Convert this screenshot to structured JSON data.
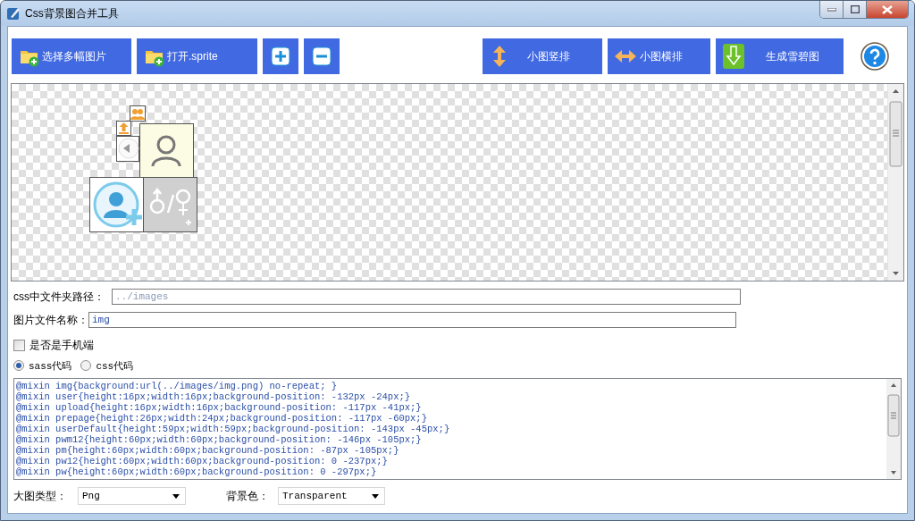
{
  "window": {
    "title": "Css背景图合并工具"
  },
  "toolbar": [
    {
      "kind": "folder",
      "label": "选择多幅图片"
    },
    {
      "kind": "folder",
      "label": "打开.sprite"
    },
    {
      "kind": "plus"
    },
    {
      "kind": "minus"
    },
    {
      "kind": "vertical",
      "label": "小图竖排"
    },
    {
      "kind": "horizontal",
      "label": "小图横排"
    },
    {
      "kind": "generate",
      "label": "生成雪碧图"
    },
    {
      "kind": "help"
    }
  ],
  "css_folder_path": {
    "label": "css中文件夹路径：",
    "value": "../images"
  },
  "image_file_name": {
    "label": "图片文件名称：",
    "value": "img"
  },
  "mobile_checkbox": {
    "label": "是否是手机端",
    "checked": false
  },
  "code_format": [
    {
      "label": "sass代码",
      "selected": true
    },
    {
      "label": "css代码",
      "selected": false
    }
  ],
  "code_output": [
    "@mixin img{background:url(../images/img.png) no-repeat; }",
    "@mixin user{height:16px;width:16px;background-position: -132px -24px;}",
    "@mixin upload{height:16px;width:16px;background-position: -117px -41px;}",
    "@mixin prepage{height:26px;width:24px;background-position: -117px -60px;}",
    "@mixin userDefault{height:59px;width:59px;background-position: -143px -45px;}",
    "@mixin pwm12{height:60px;width:60px;background-position: -146px -105px;}",
    "@mixin pm{height:60px;width:60px;background-position: -87px -105px;}",
    "@mixin pw12{height:60px;width:60px;background-position: 0 -237px;}",
    "@mixin pw{height:60px;width:60px;background-position: 0 -297px;}"
  ],
  "image_type": {
    "label": "大图类型：",
    "value": "Png"
  },
  "background_color": {
    "label": "背景色：",
    "value": "Transparent"
  }
}
